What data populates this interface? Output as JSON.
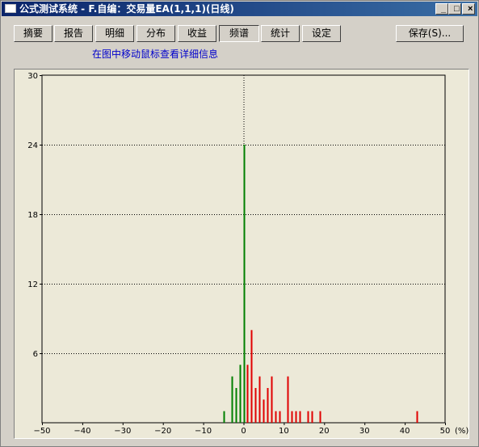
{
  "window": {
    "title": "公式测试系统 - F.自编：交易量EA(1,1,1)(日线)",
    "min_glyph": "_",
    "max_glyph": "□",
    "close_glyph": "×"
  },
  "tabs": [
    {
      "label": "摘要"
    },
    {
      "label": "报告"
    },
    {
      "label": "明细"
    },
    {
      "label": "分布"
    },
    {
      "label": "收益"
    },
    {
      "label": "频谱"
    },
    {
      "label": "统计"
    },
    {
      "label": "设定"
    }
  ],
  "active_tab": "频谱",
  "save_button": "保存(S)...",
  "hint": "在图中移动鼠标查看详细信息",
  "colors": {
    "positive": "#e00000",
    "negative": "#008000",
    "zero": "#008000"
  },
  "chart_data": {
    "type": "bar",
    "x_unit": "(%)",
    "xlim": [
      -50,
      50
    ],
    "ylim": [
      0,
      30
    ],
    "x_ticks": [
      -50,
      -40,
      -30,
      -20,
      -10,
      0,
      10,
      20,
      30,
      40,
      50
    ],
    "y_ticks": [
      6,
      12,
      18,
      24,
      30
    ],
    "grid": "dotted horizontal at y ticks, dotted vertical at x=0",
    "series": [
      {
        "x": -5,
        "y": 1
      },
      {
        "x": -3,
        "y": 4
      },
      {
        "x": -2,
        "y": 3
      },
      {
        "x": -1,
        "y": 5
      },
      {
        "x": 0,
        "y": 24
      },
      {
        "x": 1,
        "y": 5
      },
      {
        "x": 2,
        "y": 8
      },
      {
        "x": 3,
        "y": 3
      },
      {
        "x": 4,
        "y": 4
      },
      {
        "x": 5,
        "y": 2
      },
      {
        "x": 6,
        "y": 3
      },
      {
        "x": 7,
        "y": 4
      },
      {
        "x": 8,
        "y": 1
      },
      {
        "x": 9,
        "y": 1
      },
      {
        "x": 11,
        "y": 4
      },
      {
        "x": 12,
        "y": 1
      },
      {
        "x": 13,
        "y": 1
      },
      {
        "x": 14,
        "y": 1
      },
      {
        "x": 16,
        "y": 1
      },
      {
        "x": 17,
        "y": 1
      },
      {
        "x": 19,
        "y": 1
      },
      {
        "x": 43,
        "y": 1
      }
    ]
  }
}
